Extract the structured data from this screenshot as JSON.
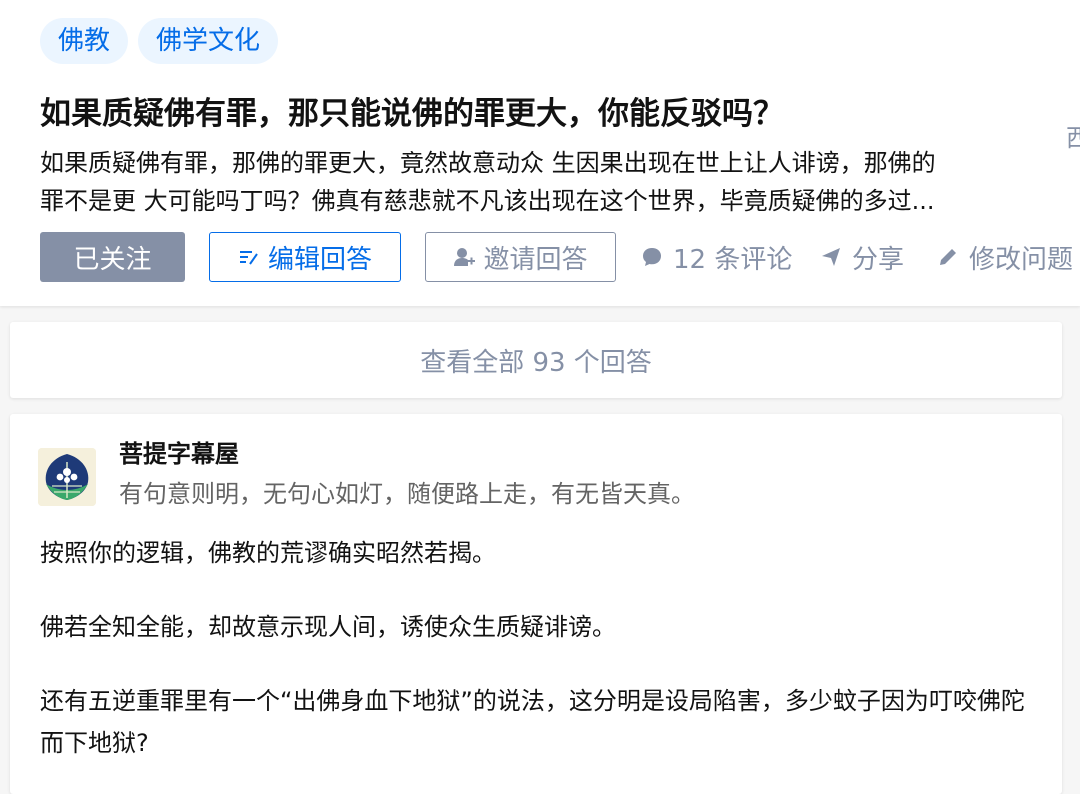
{
  "tags": [
    "佛教",
    "佛学文化"
  ],
  "question": {
    "title": "如果质疑佛有罪，那只能说佛的罪更大，你能反驳吗？",
    "detail_lines": [
      "如果质疑佛有罪，那佛的罪更大，竟然故意动众 生因果出现在世上让人诽谤，那佛的",
      "罪不是更 大可能吗丁吗？佛真有慈悲就不凡该出现在这个世界，毕竟质疑佛的多过..."
    ],
    "side_glyph": "西"
  },
  "actions": {
    "followed_label": "已关注",
    "edit_label": "编辑回答",
    "invite_label": "邀请回答",
    "comments_label": "12 条评论",
    "share_label": "分享",
    "modify_label": "修改问题"
  },
  "view_all_label": "查看全部 93 个回答",
  "answer": {
    "author_name": "菩提字幕屋",
    "author_bio": "有句意则明，无句心如灯，随便路上走，有无皆天真。",
    "paragraphs": [
      "按照你的逻辑，佛教的荒谬确实昭然若揭。",
      "佛若全知全能，却故意示现人间，诱使众生质疑诽谤。",
      "还有五逆重罪里有一个“出佛身血下地狱”的说法，这分明是设局陷害，多少蚊子因为叮咬佛陀而下地狱?"
    ]
  },
  "colors": {
    "brand_blue": "#056de8",
    "tag_bg": "#ebf5ff",
    "muted_gray": "#8590a6",
    "page_bg": "#f6f6f6"
  },
  "icons": {
    "edit": "edit-answer-icon",
    "invite": "invite-user-icon",
    "comment": "comment-bubble-icon",
    "share": "share-paper-plane-icon",
    "modify": "pencil-icon",
    "avatar": "bodhi-leaf-avatar"
  }
}
